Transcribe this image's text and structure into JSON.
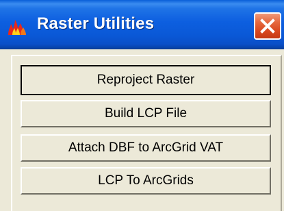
{
  "window": {
    "title": "Raster Utilities",
    "app_icon": "fire-icon",
    "close_icon": "close-icon",
    "close_color": "#e5683e",
    "titlebar_color": "#0a58d6"
  },
  "buttons": [
    {
      "label": "Reproject Raster",
      "default": true
    },
    {
      "label": "Build LCP File",
      "default": false
    },
    {
      "label": "Attach DBF to ArcGrid VAT",
      "default": false
    },
    {
      "label": "LCP To ArcGrids",
      "default": false
    }
  ]
}
